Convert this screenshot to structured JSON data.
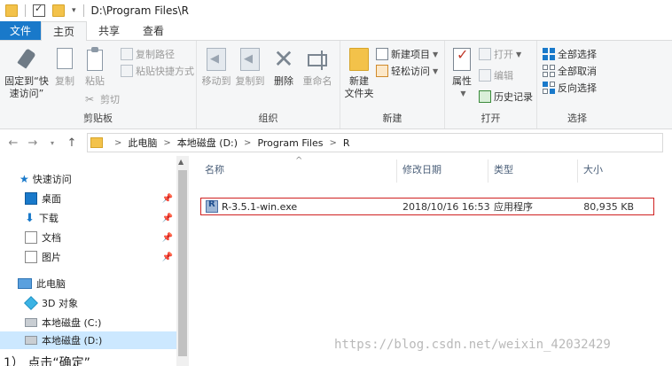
{
  "window": {
    "title": "D:\\Program Files\\R"
  },
  "tabs": [
    {
      "label": "文件"
    },
    {
      "label": "主页"
    },
    {
      "label": "共享"
    },
    {
      "label": "查看"
    }
  ],
  "ribbon": {
    "clipboard": {
      "label": "剪贴板",
      "pin": "固定到“快\n速访问”",
      "copy": "复制",
      "paste": "粘贴",
      "copy_path": "复制路径",
      "paste_shortcut": "粘贴快捷方式",
      "cut": "剪切"
    },
    "organize": {
      "label": "组织",
      "move_to": "移动到",
      "copy_to": "复制到",
      "delete": "删除",
      "rename": "重命名"
    },
    "new": {
      "label": "新建",
      "new_folder": "新建\n文件夹",
      "new_item": "新建项目",
      "easy_access": "轻松访问"
    },
    "open": {
      "label": "打开",
      "properties": "属性",
      "open": "打开",
      "edit": "编辑",
      "history": "历史记录"
    },
    "select": {
      "label": "选择",
      "select_all": "全部选择",
      "select_none": "全部取消",
      "invert": "反向选择"
    }
  },
  "address": {
    "crumbs": [
      "此电脑",
      "本地磁盘 (D:)",
      "Program Files",
      "R"
    ]
  },
  "nav": {
    "quick_access": "快速访问",
    "desktop": "桌面",
    "downloads": "下载",
    "documents": "文档",
    "pictures": "图片",
    "this_pc": "此电脑",
    "objects3d": "3D 对象",
    "drive_c": "本地磁盘 (C:)",
    "drive_d": "本地磁盘 (D:)"
  },
  "columns": {
    "name": "名称",
    "date": "修改日期",
    "type": "类型",
    "size": "大小"
  },
  "files": [
    {
      "name": "R-3.5.1-win.exe",
      "date": "2018/10/16 16:53",
      "type": "应用程序",
      "size": "80,935 KB"
    }
  ],
  "watermark": "https://blog.csdn.net/weixin_42032429",
  "bottom_text": "1） 点击“确定”"
}
